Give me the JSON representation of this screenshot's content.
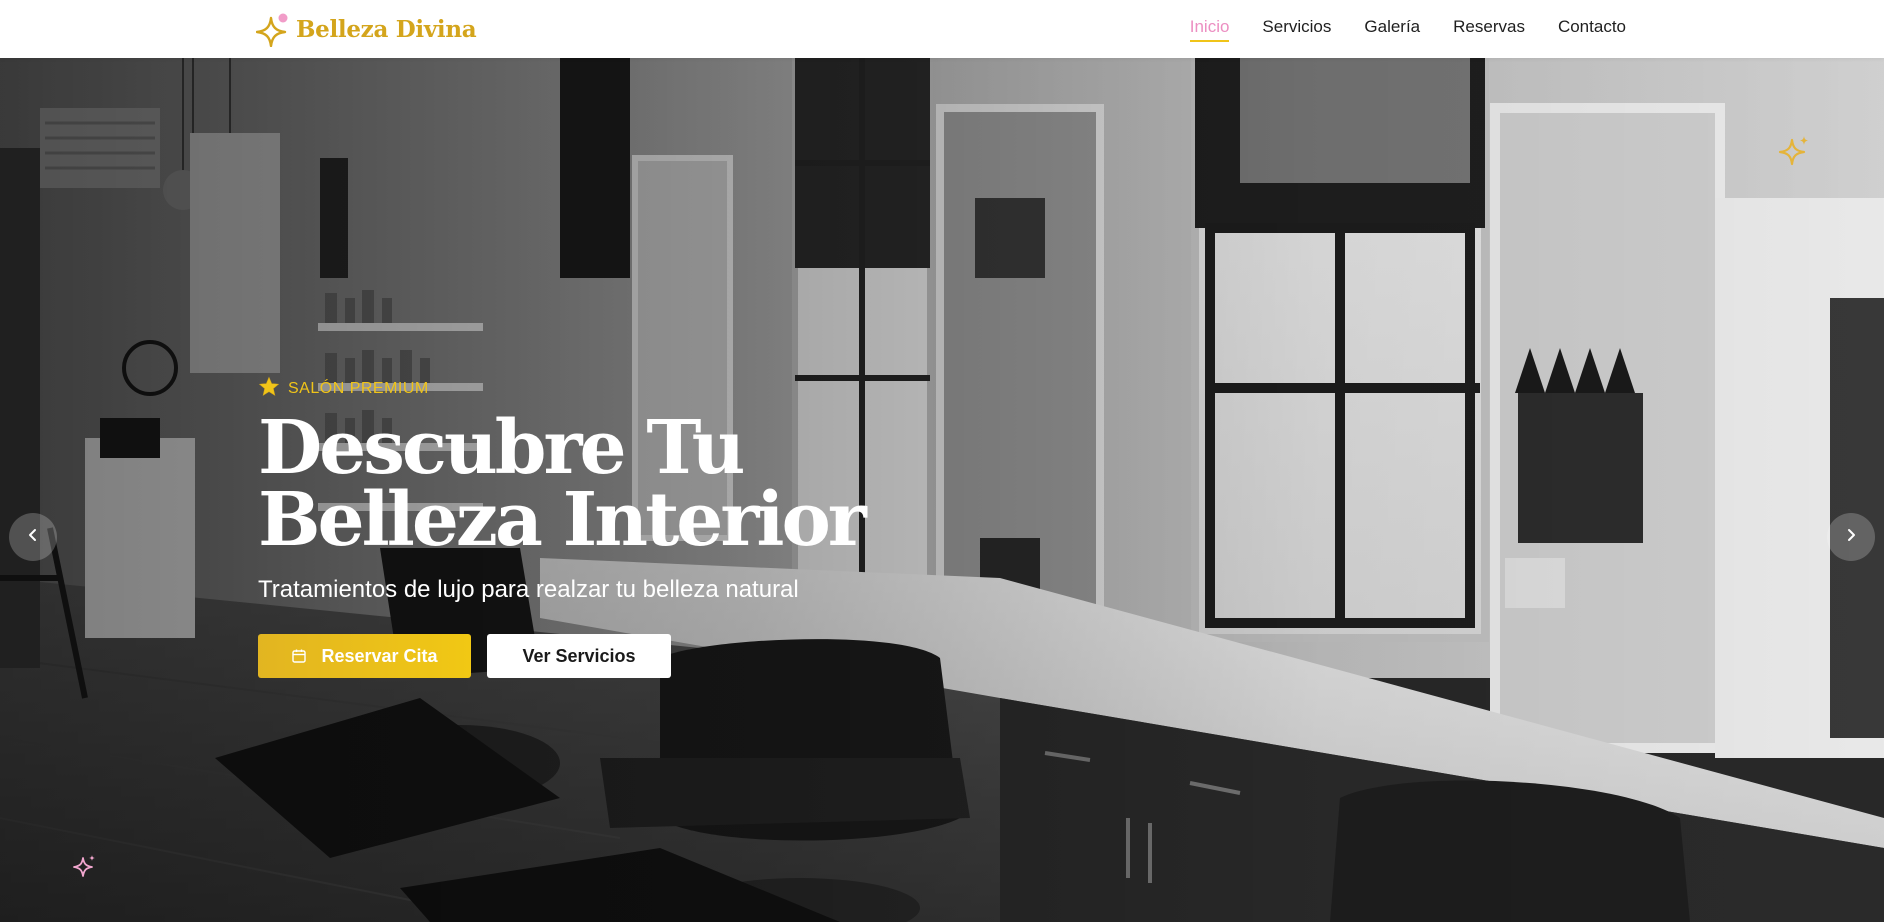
{
  "brand": {
    "name": "Belleza Divina",
    "logo_icon": "sparkle-star-icon",
    "accent_color": "#d4a51c",
    "pink_color": "#ec8fc2"
  },
  "nav": {
    "items": [
      {
        "label": "Inicio",
        "active": true
      },
      {
        "label": "Servicios",
        "active": false
      },
      {
        "label": "Galería",
        "active": false
      },
      {
        "label": "Reservas",
        "active": false
      },
      {
        "label": "Contacto",
        "active": false
      }
    ]
  },
  "hero": {
    "badge": {
      "icon": "star-icon",
      "label": "SALÓN PREMIUM"
    },
    "title_line1": "Descubre Tu",
    "title_line2": "Belleza Interior",
    "subtitle": "Tratamientos de lujo para realzar tu belleza natural",
    "primary_button": {
      "icon": "calendar-icon",
      "label": "Reservar Cita",
      "color": "#f0c419"
    },
    "secondary_button": {
      "label": "Ver Servicios"
    },
    "carousel": {
      "prev_icon": "chevron-left-icon",
      "next_icon": "chevron-right-icon"
    },
    "background_image": "black-and-white salon interior with styling chairs, mirrors and windows"
  }
}
